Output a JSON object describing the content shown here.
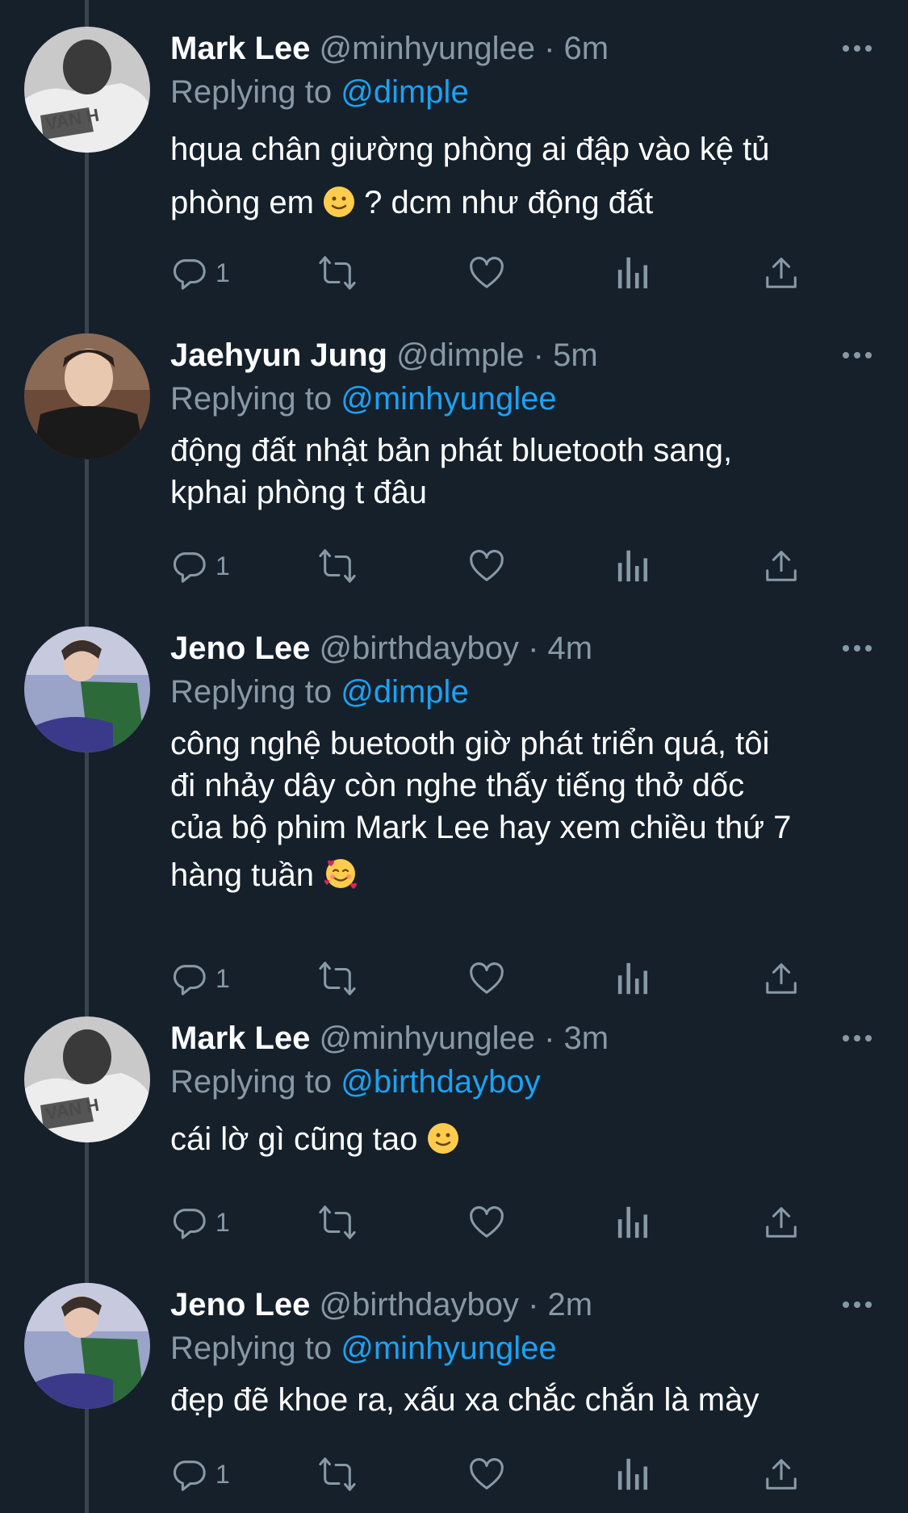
{
  "tweets": [
    {
      "name": "Mark Lee",
      "handle": "@minhyunglee",
      "time": "6m",
      "replying_label": "Replying to",
      "replying_to": "@dimple",
      "text_lines": [
        "hqua chân giường phòng ai đập vào kệ tủ",
        "phòng em",
        "? dcm như động đất"
      ],
      "emoji": "slightly-smiling-face",
      "reply_count": "1",
      "avatar": "mark-lee-avatar"
    },
    {
      "name": "Jaehyun Jung",
      "handle": "@dimple",
      "time": "5m",
      "replying_label": "Replying to",
      "replying_to": "@minhyunglee",
      "text_lines": [
        "động đất nhật bản phát bluetooth sang,",
        "kphai phòng t đâu"
      ],
      "reply_count": "1",
      "avatar": "jaehyun-jung-avatar"
    },
    {
      "name": "Jeno Lee",
      "handle": "@birthdayboy",
      "time": "4m",
      "replying_label": "Replying to",
      "replying_to": "@dimple",
      "text_lines": [
        "công nghệ buetooth giờ phát triển quá, tôi",
        "đi nhảy dây còn nghe thấy tiếng thở dốc",
        "của bộ phim Mark Lee hay xem chiều thứ 7",
        "hàng tuần"
      ],
      "emoji": "smiling-face-with-hearts",
      "reply_count": "1",
      "avatar": "jeno-lee-avatar"
    },
    {
      "name": "Mark Lee",
      "handle": "@minhyunglee",
      "time": "3m",
      "replying_label": "Replying to",
      "replying_to": "@birthdayboy",
      "text_lines": [
        "cái lờ gì cũng tao"
      ],
      "emoji": "slightly-smiling-face",
      "reply_count": "1",
      "avatar": "mark-lee-avatar"
    },
    {
      "name": "Jeno Lee",
      "handle": "@birthdayboy",
      "time": "2m",
      "replying_label": "Replying to",
      "replying_to": "@minhyunglee",
      "text_lines": [
        "đẹp đẽ khoe ra, xấu xa chắc chắn là mày"
      ],
      "reply_count": "1",
      "avatar": "jeno-lee-avatar"
    }
  ],
  "separator": "·",
  "colors": {
    "background": "#15202b",
    "text": "#ffffff",
    "secondary": "#8899a6",
    "link": "#1da1f2",
    "thread_line": "#38444d"
  }
}
